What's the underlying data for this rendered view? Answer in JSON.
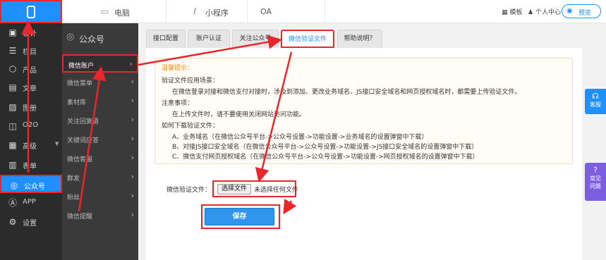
{
  "topbar": {
    "tabs": [
      {
        "label": "电脑",
        "icon": "monitor-icon"
      },
      {
        "label": "小程序",
        "icon": "mini-program-icon"
      },
      {
        "label": "OA",
        "icon": "oa-icon"
      }
    ],
    "template_label": "模板",
    "user_center_label": "个人中心",
    "preview_label": "预览"
  },
  "rail": {
    "items": [
      {
        "label": "设计",
        "icon": "design-icon"
      },
      {
        "label": "栏目",
        "icon": "columns-icon"
      },
      {
        "label": "产品",
        "icon": "product-icon"
      },
      {
        "label": "文章",
        "icon": "article-icon"
      },
      {
        "label": "图册",
        "icon": "album-icon"
      },
      {
        "label": "O2O",
        "icon": "o2o-icon"
      },
      {
        "label": "高级",
        "icon": "advanced-icon"
      },
      {
        "label": "表单",
        "icon": "form-icon"
      },
      {
        "label": "公众号",
        "icon": "wechat-icon",
        "active": true
      },
      {
        "label": "APP",
        "icon": "app-icon"
      },
      {
        "label": "设置",
        "icon": "settings-icon"
      }
    ]
  },
  "subnav": {
    "header": "公众号",
    "items": [
      {
        "label": "微信账户",
        "active": true
      },
      {
        "label": "微信菜单"
      },
      {
        "label": "素材库"
      },
      {
        "label": "关注回复语"
      },
      {
        "label": "关键词应答"
      },
      {
        "label": "微信客服"
      },
      {
        "label": "群发"
      },
      {
        "label": "粉丝"
      },
      {
        "label": "微信提醒"
      }
    ]
  },
  "tabs": [
    {
      "label": "接口配置"
    },
    {
      "label": "账户认证"
    },
    {
      "label": "关注公众号"
    },
    {
      "label": "微信验证文件",
      "active": true
    },
    {
      "label": "帮助说明？"
    }
  ],
  "notice": {
    "title": "温馨提示：",
    "lines": [
      "验证文件应用场景：",
      "在微信登录对接和微信支付对接时，涉及到添加、更改业务域名、JS接口安全域名和网页授权域名时，都需要上传验证文件。",
      "注意事项：",
      "在上传文件时，请不要使用关闭网站访问功能。",
      "如何下载验证文件：",
      "A、业务域名（在微信公众号平台->公众号设置->功能设置->业务域名的设置弹窗中下载）",
      "B、对接JS接口安全域名（在微信公众号平台->公众号设置->功能设置->JS接口安全域名的设置弹窗中下载）",
      "C、微信支付网页授权域名（在微信公众号平台->公众号设置->功能设置->网页授权域名的设置弹窗中下载）"
    ]
  },
  "upload": {
    "label": "微信验证文件：",
    "button": "选择文件",
    "status": "未选择任何文件"
  },
  "save_label": "保存",
  "float": {
    "service": "客服",
    "faq_1": "常见",
    "faq_2": "问题"
  },
  "colors": {
    "accent": "#1e90ff",
    "highlight": "#e8262b",
    "rail_bg": "#2b2b2b",
    "notice_title": "#f08a1c"
  }
}
